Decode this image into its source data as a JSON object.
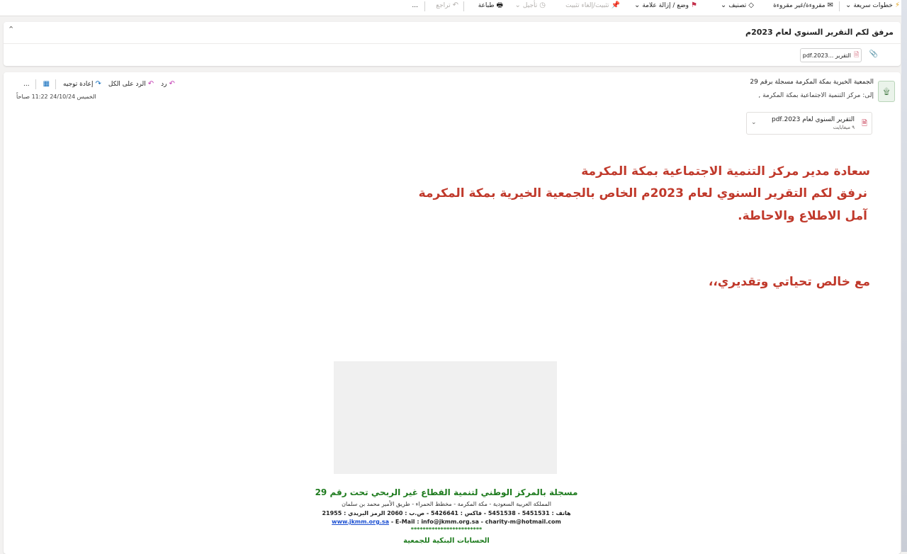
{
  "toolbar": {
    "quick_steps": "خطوات سريعة",
    "read_unread": "مقروءة/غير مقروءة",
    "categorize": "تصنيف",
    "flag": "وضع / إزالة علامة",
    "pin": "تثبيت/إلغاء تثبيت",
    "snooze": "تأجيل",
    "print": "طباعة",
    "undo": "تراجع",
    "more": "..."
  },
  "email": {
    "subject": "مرفق لكم التقرير السنوي لعام 2023م",
    "attachment_chip": "التقرير ...2023.pdf",
    "sender": "الجمعية الخيرية بمكة المكرمة مسجلة برقم 29",
    "to_label": "إلى:",
    "to": "مركز التنمية الاجتماعية بمكة المكرمة ,",
    "date": "الخميس 24/10/24 11:22 صباحاً",
    "actions": {
      "reply": "رد",
      "reply_all": "الرد على الكل",
      "forward": "إعادة توجيه",
      "more": "..."
    },
    "attachment": {
      "name": "التقرير السنوي لعام 2023.pdf",
      "size": "٩ ميغابايت"
    },
    "body": {
      "line1": "سعادة مدير مركز التنمية الاجتماعية بمكة المكرمة",
      "line2": "نرفق لكم التقرير السنوي لعام 2023م الخاص بالجمعية الخيرية بمكة المكرمة",
      "line3": "آمل الاطلاع والاحاطة.",
      "closing": "مع خالص تحياتي وتقديري،،"
    },
    "signature": {
      "title": "مسجلة بالمركز الوطني لتنمية القطاع غير الربحي تحت رقم 29",
      "address": "المملكة العربية السعودية - مكة المكرمة - مخطط الحمراء - طريق الأمير محمد بن سلمان",
      "phone": "هاتف : 5451531 - 5451538 - فاكس : 5426641 - ص.ب : 2060 الرمز البريدي : 21955",
      "web": "www.jkmm.org.sa",
      "email_line": "- E-Mail : info@jkmm.org.sa - charity-m@hotmail.com",
      "stars": "************************",
      "bank_title": "الحسابات البنكية للجمعية"
    }
  },
  "colors": {
    "body_text": "#c0392b",
    "signature_green": "#1e7b1e",
    "link": "#1a4ed1"
  }
}
